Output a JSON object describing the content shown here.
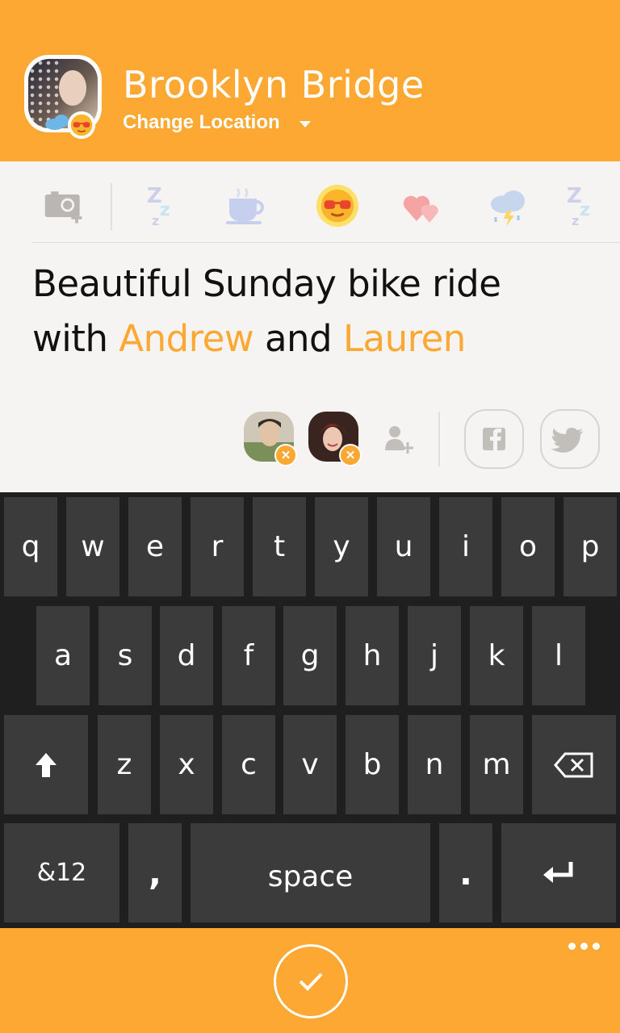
{
  "header": {
    "title": "Brooklyn Bridge",
    "change_location_label": "Change Location"
  },
  "moods": [
    {
      "name": "add-photo",
      "icon": "camera-add-icon"
    },
    {
      "name": "sleepy",
      "icon": "zzz-icon"
    },
    {
      "name": "coffee",
      "icon": "coffee-cup-icon"
    },
    {
      "name": "sunny",
      "icon": "sun-sunglasses-icon",
      "selected": true
    },
    {
      "name": "love",
      "icon": "hearts-icon"
    },
    {
      "name": "stormy",
      "icon": "storm-cloud-icon"
    },
    {
      "name": "sleepy-2",
      "icon": "zzz-icon"
    }
  ],
  "post": {
    "line1": "Beautiful Sunday bike ride",
    "line2_prefix": "with ",
    "tag1": "Andrew",
    "line2_mid": " and ",
    "tag2": "Lauren"
  },
  "people": [
    {
      "name": "Andrew",
      "icon": "person-avatar"
    },
    {
      "name": "Lauren",
      "icon": "person-avatar"
    }
  ],
  "share": [
    {
      "name": "facebook",
      "icon": "facebook-icon"
    },
    {
      "name": "twitter",
      "icon": "twitter-icon"
    }
  ],
  "keyboard": {
    "row1": [
      "q",
      "w",
      "e",
      "r",
      "t",
      "y",
      "u",
      "i",
      "o",
      "p"
    ],
    "row2": [
      "a",
      "s",
      "d",
      "f",
      "g",
      "h",
      "j",
      "k",
      "l"
    ],
    "row3": [
      "z",
      "x",
      "c",
      "v",
      "b",
      "n",
      "m"
    ],
    "symbols_label": "&12",
    "comma_label": ",",
    "space_label": "space",
    "period_label": "."
  },
  "colors": {
    "accent": "#fca832",
    "keyboard_bg": "#1f1f1f",
    "key_bg": "#3b3b3b"
  }
}
